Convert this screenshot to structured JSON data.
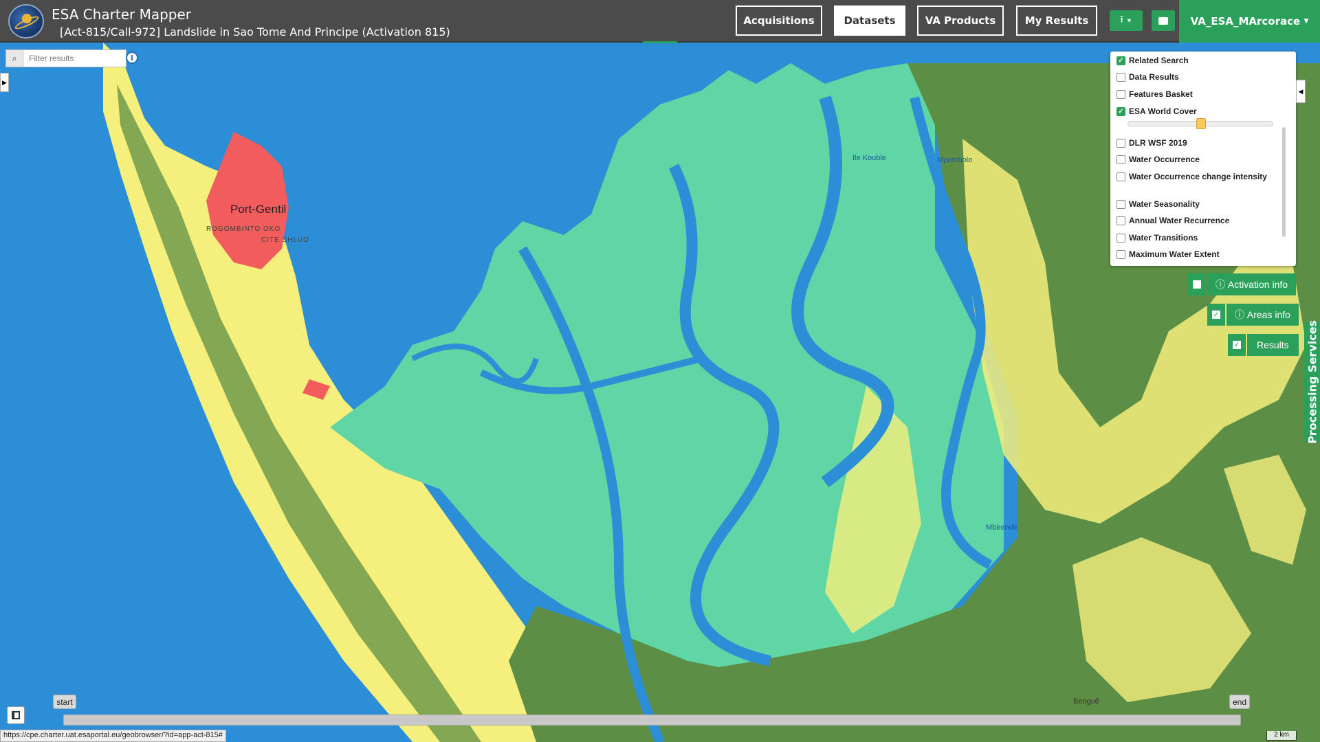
{
  "header": {
    "app_title": "ESA Charter Mapper",
    "activation_title": "[Act-815/Call-972] Landslide in Sao Tome And Principe (Activation 815)",
    "nav": [
      "Acquisitions",
      "Datasets",
      "VA Products",
      "My Results"
    ],
    "active_nav": "Datasets",
    "user": "VA_ESA_MArcorace"
  },
  "filter": {
    "placeholder": "Filter results"
  },
  "layers": [
    {
      "label": "Related Search",
      "checked": true
    },
    {
      "label": "Data Results",
      "checked": false
    },
    {
      "label": "Features Basket",
      "checked": false
    },
    {
      "label": "ESA World Cover",
      "checked": true
    },
    {
      "label": "DLR WSF 2019",
      "checked": false
    },
    {
      "label": "Water Occurrence",
      "checked": false
    },
    {
      "label": "Water Occurrence change intensity",
      "checked": false
    },
    {
      "label": "Water Seasonality",
      "checked": false
    },
    {
      "label": "Annual Water Recurrence",
      "checked": false
    },
    {
      "label": "Water Transitions",
      "checked": false
    },
    {
      "label": "Maximum Water Extent",
      "checked": false
    }
  ],
  "info_buttons": {
    "activation": {
      "label": "Activation info",
      "checked": false
    },
    "areas": {
      "label": "Areas info",
      "checked": true
    },
    "results": {
      "label": "Results",
      "checked": true
    }
  },
  "processing_tab": "Processing Services",
  "map_labels": {
    "city": "Port-Gentil",
    "district1": "ROGOMBINTO OKO",
    "district2": "CITE SHLUO",
    "place1": "Ile Kouble",
    "place2": "Mpombolo",
    "place3": "Mbirendé",
    "place4": "Benguê"
  },
  "timeline": {
    "start": "start",
    "end": "end"
  },
  "status_url": "https://cpe.charter.uat.esaportal.eu/geobrowser/?id=app-act-815#",
  "scale": "2 km",
  "colors": {
    "header": "#4b4b4b",
    "accent": "#2aa05a",
    "water": "#2b8ed6",
    "mangrove": "#5fd6a4",
    "forest": "#5c8f45",
    "cropland": "#f5ef7c",
    "built": "#f25c5c"
  }
}
